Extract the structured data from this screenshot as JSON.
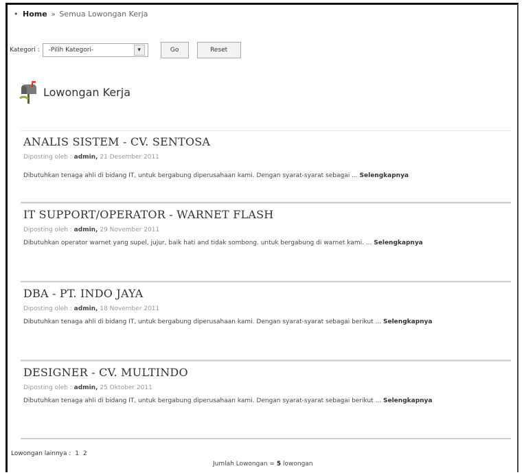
{
  "breadcrumb": {
    "home": "Home",
    "current": "Semua Lowongan Kerja"
  },
  "filter": {
    "label": "Kategori :",
    "select_value": "-Pilih Kategori-",
    "go_label": "Go",
    "reset_label": "Reset"
  },
  "section": {
    "title": "Lowongan Kerja"
  },
  "jobs": [
    {
      "title": "ANALIS SISTEM - CV. SENTOSA",
      "posted_prefix": "Diposting oleh :",
      "author": "admin,",
      "date": "21 Desember 2011",
      "description": "Dibutuhkan tenaga ahli di bidang IT, untuk bergabung diperusahaan kami. Dengan syarat-syarat sebagai ...",
      "more": "Selengkapnya"
    },
    {
      "title": "IT SUPPORT/OPERATOR - WARNET FLASH",
      "posted_prefix": "Diposting oleh :",
      "author": "admin,",
      "date": "29 November 2011",
      "description": "Dibutuhkan operator warnet yang supel, jujur, baik hati and tidak sombong. untuk bergabung di warnet kami. ...",
      "more": "Selengkapnya"
    },
    {
      "title": "DBA - PT. INDO JAYA",
      "posted_prefix": "Diposting oleh :",
      "author": "admin,",
      "date": "18 November 2011",
      "description": "Dibutuhkan tenaga ahli di bidang IT, untuk bergabung diperusahaan kami. Dengan syarat-syarat sebagai berikut ...",
      "more": "Selengkapnya"
    },
    {
      "title": "DESIGNER - CV. MULTINDO",
      "posted_prefix": "Diposting oleh :",
      "author": "admin,",
      "date": "25 Oktober 2011",
      "description": "Dibutuhkan tenaga ahli di bidang IT, untuk bergabung diperusahaan kami. Dengan syarat-syarat sebagai berikut ...",
      "more": "Selengkapnya"
    }
  ],
  "pagination": {
    "label": "Lowongan lainnya :",
    "pages": [
      "1",
      "2"
    ]
  },
  "total": {
    "prefix": "Jumlah Lowongan =",
    "count": "5",
    "suffix": "lowongan"
  }
}
